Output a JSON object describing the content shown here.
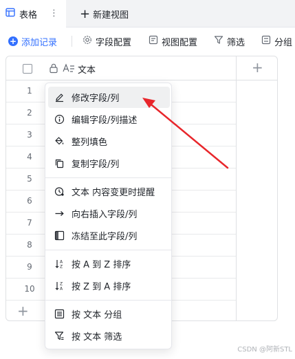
{
  "tabs": {
    "active_label": "表格",
    "more": "⋮",
    "new_view_label": "新建视图"
  },
  "toolbar": {
    "add_record": "添加记录",
    "field_config": "字段配置",
    "view_config": "视图配置",
    "filter": "筛选",
    "group": "分组"
  },
  "grid": {
    "header_label": "文本",
    "row_numbers": [
      "1",
      "2",
      "3",
      "4",
      "5",
      "6",
      "7",
      "8",
      "9",
      "10"
    ]
  },
  "menu": {
    "items": [
      {
        "label": "修改字段/列",
        "icon": "pencil-icon"
      },
      {
        "label": "编辑字段/列描述",
        "icon": "info-icon"
      },
      {
        "label": "整列填色",
        "icon": "paint-bucket-icon"
      },
      {
        "label": "复制字段/列",
        "icon": "copy-icon"
      },
      {
        "label": "文本 内容变更时提醒",
        "icon": "reminder-icon"
      },
      {
        "label": "向右插入字段/列",
        "icon": "arrow-right-icon"
      },
      {
        "label": "冻结至此字段/列",
        "icon": "freeze-icon"
      },
      {
        "label": "按 A 到 Z 排序",
        "icon": "sort-az-icon"
      },
      {
        "label": "按 Z 到 A 排序",
        "icon": "sort-za-icon"
      },
      {
        "label": "按 文本 分组",
        "icon": "group-icon"
      },
      {
        "label": "按 文本 筛选",
        "icon": "filter-icon"
      }
    ]
  },
  "colors": {
    "accent": "#3370ff",
    "annotation_arrow": "#e8262b"
  },
  "watermark": "CSDN @阿新STL"
}
